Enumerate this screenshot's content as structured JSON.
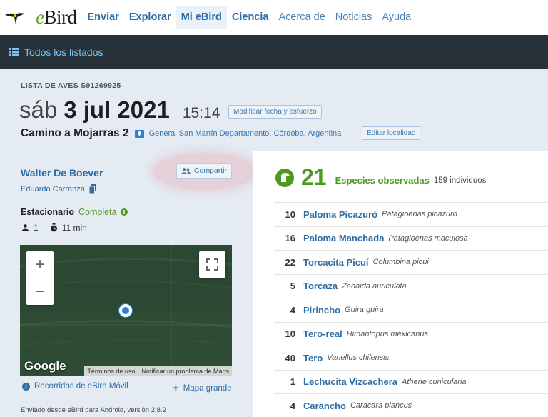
{
  "nav": {
    "logo_text": "eBird",
    "items": [
      {
        "label": "Enviar",
        "style": "bold"
      },
      {
        "label": "Explorar",
        "style": "bold"
      },
      {
        "label": "Mi eBird",
        "style": "bold-active"
      },
      {
        "label": "Ciencia",
        "style": "bold"
      },
      {
        "label": "Acerca de",
        "style": "light"
      },
      {
        "label": "Noticias",
        "style": "light"
      },
      {
        "label": "Ayuda",
        "style": "light"
      }
    ]
  },
  "subnav": {
    "all_checklists_label": "Todos los listados",
    "icon": "list-icon"
  },
  "header": {
    "checklist_id": "LISTA DE AVES S91269925",
    "weekday": "sáb",
    "date": "3 jul 2021",
    "time": "15:14",
    "modify_button": "Modificar fecha y esfuerzo",
    "location_name": "Camino a Mojarras 2",
    "region": "General San Martín Departamento,  Córdoba,  Argentina",
    "edit_location_button": "Editar localidad"
  },
  "sidebar": {
    "observer": "Walter De Boever",
    "share_button": "Compartir",
    "shared_with": "Eduardo Carranza",
    "protocol": "Estacionario",
    "complete_label": "Completa",
    "party_size": "1",
    "duration": "11 min",
    "map": {
      "provider": "Google",
      "terms": "Términos de uso",
      "report": "Notificar un problema de Maps"
    },
    "mobile_tracks": "Recorridos de eBird Móvil",
    "big_map": "Mapa grande",
    "sent_from": "Enviado desde eBird para Android, versión 2.8.2"
  },
  "summary": {
    "species_count": "21",
    "species_label": "Especies observadas",
    "individuals": "159 individuos"
  },
  "observations": [
    {
      "count": "10",
      "common": "Paloma Picazuró",
      "scientific": "Patagioenas picazuro"
    },
    {
      "count": "16",
      "common": "Paloma Manchada",
      "scientific": "Patagioenas maculosa"
    },
    {
      "count": "22",
      "common": "Torcacita Picuí",
      "scientific": "Columbina picui"
    },
    {
      "count": "5",
      "common": "Torcaza",
      "scientific": "Zenaida auriculata"
    },
    {
      "count": "4",
      "common": "Pirincho",
      "scientific": "Guira guira"
    },
    {
      "count": "10",
      "common": "Tero-real",
      "scientific": "Himantopus mexicanus"
    },
    {
      "count": "40",
      "common": "Tero",
      "scientific": "Vanellus chilensis"
    },
    {
      "count": "1",
      "common": "Lechucita Vizcachera",
      "scientific": "Athene cunicularia"
    },
    {
      "count": "4",
      "common": "Carancho",
      "scientific": "Caracara plancus"
    }
  ],
  "colors": {
    "link": "#2e6ca5",
    "green": "#4c9a1f",
    "dark_bar": "#263238",
    "header_bg": "#e4ebf2"
  }
}
